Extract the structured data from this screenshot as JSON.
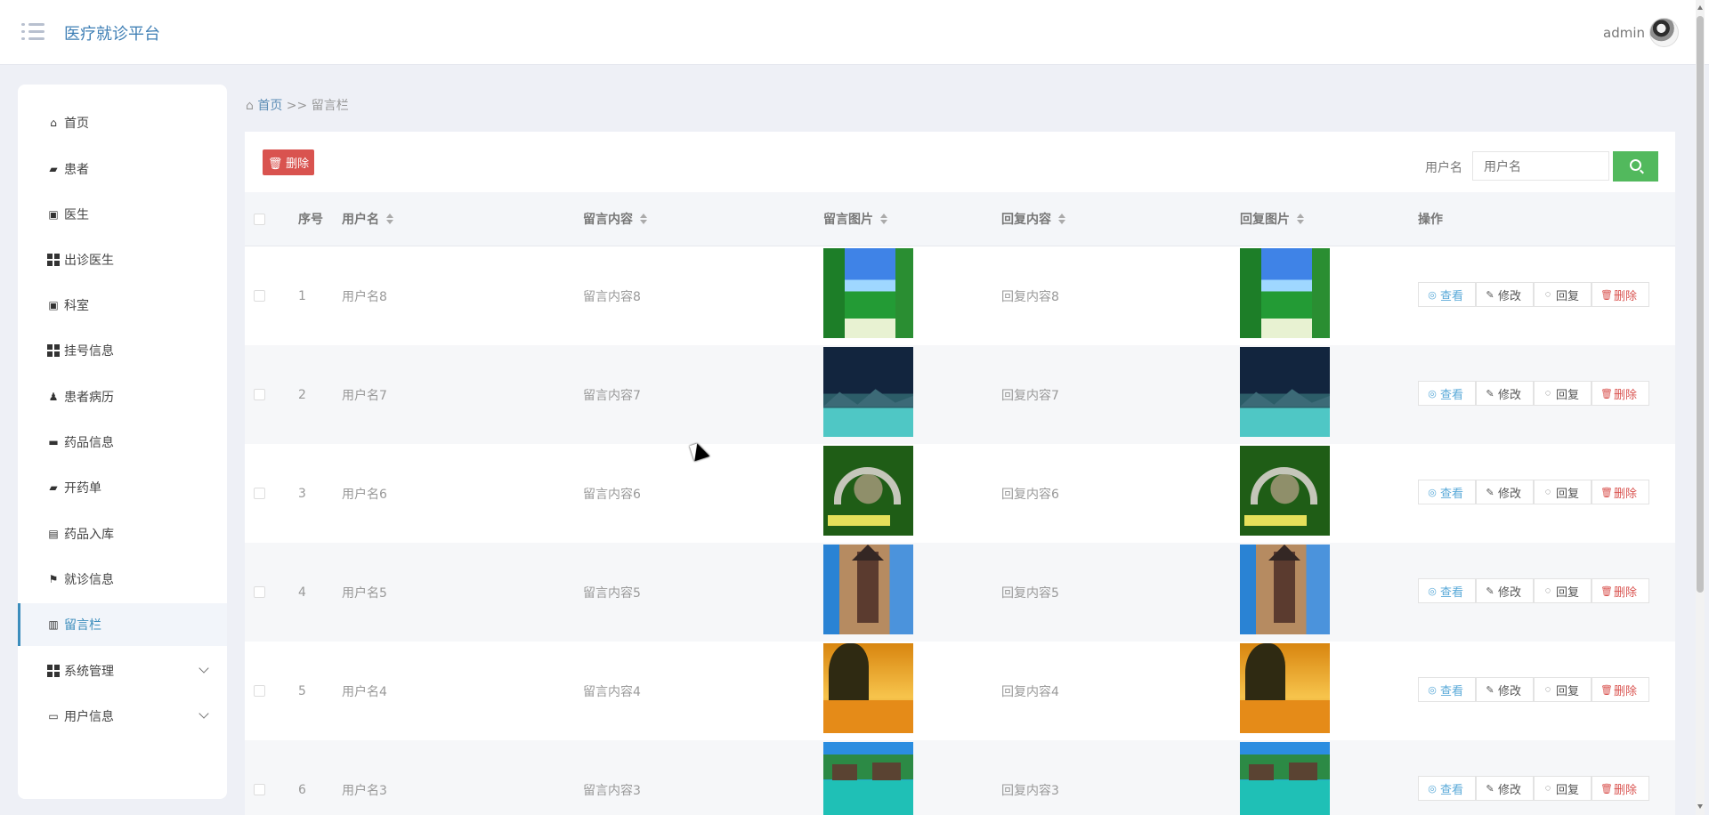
{
  "app": {
    "title": "医疗就诊平台",
    "user": "admin"
  },
  "sidebar": {
    "items": [
      {
        "label": "首页",
        "icon": "home-icon"
      },
      {
        "label": "患者",
        "icon": "monitor-icon"
      },
      {
        "label": "医生",
        "icon": "clipboard-x-icon"
      },
      {
        "label": "出诊医生",
        "icon": "grid-icon"
      },
      {
        "label": "科室",
        "icon": "clipboard-check-icon"
      },
      {
        "label": "挂号信息",
        "icon": "grid-icon"
      },
      {
        "label": "患者病历",
        "icon": "user-icon"
      },
      {
        "label": "药品信息",
        "icon": "inbox-icon"
      },
      {
        "label": "开药单",
        "icon": "briefcase-icon"
      },
      {
        "label": "药品入库",
        "icon": "chat-icon"
      },
      {
        "label": "就诊信息",
        "icon": "flag-icon"
      },
      {
        "label": "留言栏",
        "icon": "book-icon",
        "active": true
      },
      {
        "label": "系统管理",
        "icon": "grid-icon",
        "expandable": true
      },
      {
        "label": "用户信息",
        "icon": "card-icon",
        "expandable": true
      }
    ]
  },
  "breadcrumb": {
    "home": "首页",
    "separator": ">>",
    "current": "留言栏"
  },
  "toolbar": {
    "delete_label": "删除",
    "search_label": "用户名",
    "search_placeholder": "用户名"
  },
  "table": {
    "headers": [
      "序号",
      "用户名",
      "留言内容",
      "留言图片",
      "回复内容",
      "回复图片",
      "操作"
    ],
    "actions": [
      "查看",
      "修改",
      "回复",
      "删除"
    ],
    "rows": [
      {
        "index": "1",
        "username": "用户名8",
        "content": "留言内容8",
        "reply": "回复内容8",
        "image": "meadow"
      },
      {
        "index": "2",
        "username": "用户名7",
        "content": "留言内容7",
        "reply": "回复内容7",
        "image": "night-lake"
      },
      {
        "index": "3",
        "username": "用户名6",
        "content": "留言内容6",
        "reply": "回复内容6",
        "image": "stone-bridge"
      },
      {
        "index": "4",
        "username": "用户名5",
        "content": "留言内容5",
        "reply": "回复内容5",
        "image": "old-tower"
      },
      {
        "index": "5",
        "username": "用户名4",
        "content": "留言内容4",
        "reply": "回复内容4",
        "image": "sunset-tree"
      },
      {
        "index": "6",
        "username": "用户名3",
        "content": "留言内容3",
        "reply": "回复内容3",
        "image": "water-bungalows"
      }
    ]
  }
}
